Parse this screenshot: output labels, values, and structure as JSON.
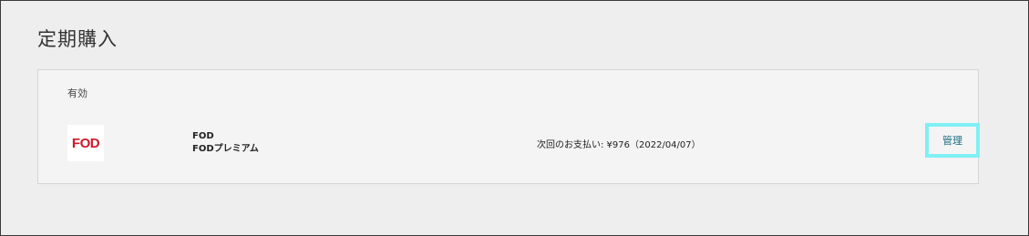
{
  "page": {
    "title": "定期購入"
  },
  "subscription": {
    "status": "有効",
    "logo_text": "FOD",
    "service_name": "FOD",
    "plan_name": "FODプレミアム",
    "next_payment": "次回のお支払い: ¥976（2022/04/07）",
    "manage_label": "管理"
  },
  "colors": {
    "logo": "#d0182a",
    "manage_text": "#1a6d80",
    "manage_highlight": "#7ff0f4"
  }
}
